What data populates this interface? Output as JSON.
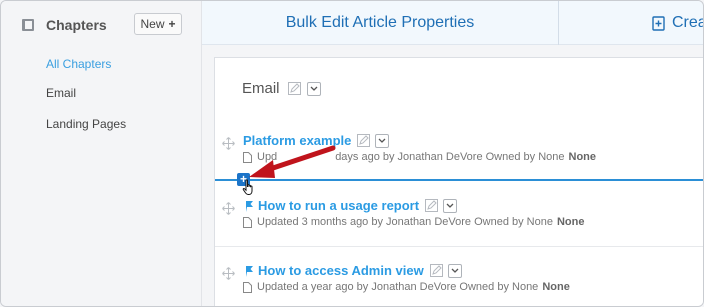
{
  "sidebar": {
    "title": "Chapters",
    "new_label": "New",
    "items": [
      {
        "label": "All Chapters",
        "active": true
      },
      {
        "label": "Email",
        "active": false
      },
      {
        "label": "Landing Pages",
        "active": false
      }
    ]
  },
  "topbar": {
    "bulk_edit_label": "Bulk Edit Article Properties",
    "create_label": "Crea"
  },
  "chapter": {
    "title": "Email"
  },
  "articles": [
    {
      "title": "Platform example",
      "meta": "Updated 3 days ago by Jonathan DeVore Owned by None",
      "visible_meta_prefix": "Upd",
      "visible_meta_suffix": "days ago by Jonathan DeVore  Owned by None",
      "owner_bold": "None",
      "pinned": false
    },
    {
      "title": "How to run a usage report",
      "meta": "Updated 3 months ago by Jonathan DeVore  Owned by None",
      "owner_bold": "None",
      "pinned": true
    },
    {
      "title": "How to access Admin view",
      "meta": "Updated a year ago by Jonathan DeVore  Owned by None",
      "owner_bold": "None",
      "pinned": true
    }
  ],
  "colors": {
    "accent": "#2b9be3",
    "link_dark": "#1f6fb5",
    "insert_line": "#2b8fd6",
    "arrow": "#c0141c"
  }
}
